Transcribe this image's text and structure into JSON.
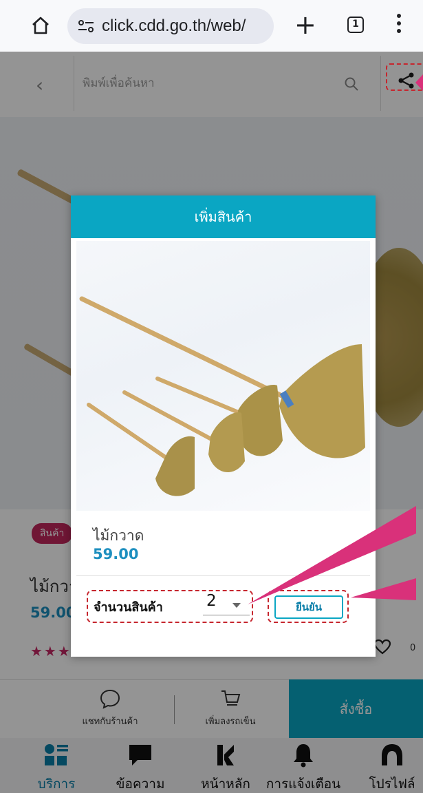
{
  "browser": {
    "url": "click.cdd.go.th/web/",
    "tab_count": "1"
  },
  "header": {
    "search_placeholder": "พิมพ์เพื่อค้นหา"
  },
  "product_page": {
    "tag": "สินค้า",
    "name": "ไม้กวา",
    "price": "59.00",
    "stars": "★★★",
    "like_count": "0"
  },
  "actions": {
    "chat_label": "แชทกับร้านค้า",
    "cart_label": "เพิ่มลงรถเข็น",
    "buy_label": "สั่งซื้อ"
  },
  "nav": {
    "items": [
      {
        "label": "บริการ",
        "icon": "grid-menu-icon",
        "color": "#0a7ea8"
      },
      {
        "label": "ข้อความ",
        "icon": "chat-icon"
      },
      {
        "label": "หน้าหลัก",
        "icon": "home-logo-icon"
      },
      {
        "label": "การแจ้งเตือน",
        "icon": "bell-icon"
      },
      {
        "label": "โปรไฟล์",
        "icon": "profile-icon"
      }
    ]
  },
  "dialog": {
    "title": "เพิ่มสินค้า",
    "product_name": "ไม้กวาด",
    "price": "59.00",
    "quantity_label": "จำนวนสินค้า",
    "quantity_value": "2",
    "confirm_label": "ยืนยัน"
  },
  "colors": {
    "accent": "#0aa6c3",
    "price": "#1d8fbf",
    "highlight": "#c6262e",
    "pointer": "#d9317a"
  }
}
